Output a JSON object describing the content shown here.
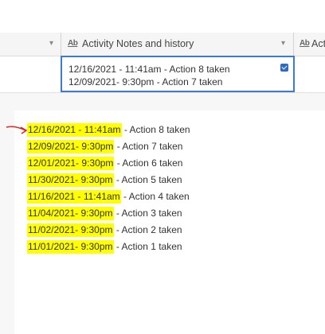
{
  "header": {
    "column_title": "Activity Notes and history",
    "next_column_partial": "Act",
    "field_type_icon": "text-field-icon",
    "dropdown_icon": "chevron-down-icon"
  },
  "cell": {
    "lines": [
      "12/16/2021 - 11:41am - Action 8 taken",
      "12/09/2021- 9:30pm - Action 7 taken"
    ],
    "checked": true
  },
  "entries": [
    {
      "date": "12/16/2021 - 11:41am",
      "rest": " - Action 8 taken"
    },
    {
      "date": "12/09/2021- 9:30pm",
      "rest": " - Action 7 taken"
    },
    {
      "date": "12/01/2021- 9:30pm",
      "rest": " - Action 6 taken"
    },
    {
      "date": "11/30/2021- 9:30pm",
      "rest": " - Action 5 taken"
    },
    {
      "date": "11/16/2021 - 11:41am",
      "rest": " - Action 4 taken"
    },
    {
      "date": "11/04/2021- 9:30pm",
      "rest": " - Action 3 taken"
    },
    {
      "date": "11/02/2021- 9:30pm",
      "rest": " - Action 2 taken"
    },
    {
      "date": "11/01/2021- 9:30pm",
      "rest": " - Action 1 taken"
    }
  ],
  "colors": {
    "highlight": "#ffff00",
    "selection_border": "#3b7bd1",
    "annotation_arrow": "#e02020"
  }
}
